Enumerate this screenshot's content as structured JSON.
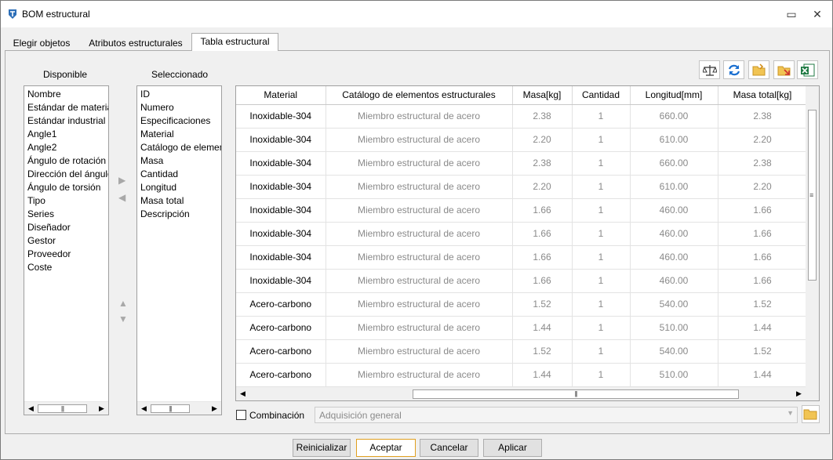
{
  "window": {
    "title": "BOM estructural",
    "pin_glyph": "▭",
    "close_glyph": "✕"
  },
  "tabs": [
    {
      "label": "Elegir objetos",
      "active": false
    },
    {
      "label": "Atributos estructurales",
      "active": false
    },
    {
      "label": "Tabla estructural",
      "active": true
    }
  ],
  "available": {
    "label": "Disponible",
    "items": [
      "Nombre",
      "Estándar de material",
      "Estándar industrial",
      "Angle1",
      "Angle2",
      "Ángulo de rotación",
      "Dirección del ángulo",
      "Ángulo de torsión",
      "Tipo",
      "Series",
      "Diseñador",
      "Gestor",
      "Proveedor",
      "Coste"
    ]
  },
  "selected": {
    "label": "Seleccionado",
    "items": [
      "ID",
      "Numero",
      "Especificaciones",
      "Material",
      "Catálogo de elementos",
      "Masa",
      "Cantidad",
      "Longitud",
      "Masa total",
      "Descripción"
    ]
  },
  "arrows": {
    "right": "▶",
    "left": "◀",
    "up": "▲",
    "down": "▼"
  },
  "toolbar": {
    "icons": [
      "balance-scale-icon",
      "refresh-icon",
      "folder-open-icon",
      "folder-export-icon",
      "excel-export-icon"
    ]
  },
  "grid": {
    "columns": [
      "Material",
      "Catálogo de elementos estructurales",
      "Masa[kg]",
      "Cantidad",
      "Longitud[mm]",
      "Masa total[kg]"
    ],
    "rows": [
      [
        "Inoxidable-304",
        "Miembro estructural de acero",
        "2.38",
        "1",
        "660.00",
        "2.38"
      ],
      [
        "Inoxidable-304",
        "Miembro estructural de acero",
        "2.20",
        "1",
        "610.00",
        "2.20"
      ],
      [
        "Inoxidable-304",
        "Miembro estructural de acero",
        "2.38",
        "1",
        "660.00",
        "2.38"
      ],
      [
        "Inoxidable-304",
        "Miembro estructural de acero",
        "2.20",
        "1",
        "610.00",
        "2.20"
      ],
      [
        "Inoxidable-304",
        "Miembro estructural de acero",
        "1.66",
        "1",
        "460.00",
        "1.66"
      ],
      [
        "Inoxidable-304",
        "Miembro estructural de acero",
        "1.66",
        "1",
        "460.00",
        "1.66"
      ],
      [
        "Inoxidable-304",
        "Miembro estructural de acero",
        "1.66",
        "1",
        "460.00",
        "1.66"
      ],
      [
        "Inoxidable-304",
        "Miembro estructural de acero",
        "1.66",
        "1",
        "460.00",
        "1.66"
      ],
      [
        "Acero-carbono",
        "Miembro estructural de acero",
        "1.52",
        "1",
        "540.00",
        "1.52"
      ],
      [
        "Acero-carbono",
        "Miembro estructural de acero",
        "1.44",
        "1",
        "510.00",
        "1.44"
      ],
      [
        "Acero-carbono",
        "Miembro estructural de acero",
        "1.52",
        "1",
        "540.00",
        "1.52"
      ],
      [
        "Acero-carbono",
        "Miembro estructural de acero",
        "1.44",
        "1",
        "510.00",
        "1.44"
      ]
    ]
  },
  "combination": {
    "checkbox_label": "Combinación",
    "checked": false,
    "select_value": "Adquisición general"
  },
  "footer": {
    "reset": "Reinicializar",
    "accept": "Aceptar",
    "cancel": "Cancelar",
    "apply": "Aplicar"
  }
}
